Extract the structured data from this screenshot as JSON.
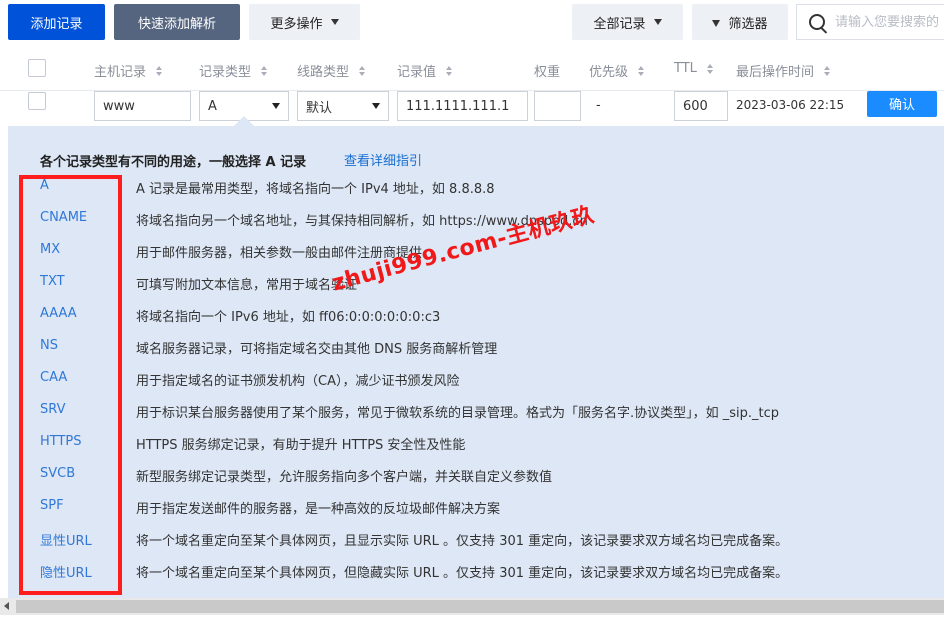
{
  "toolbar": {
    "add_record": "添加记录",
    "quick_add": "快速添加解析",
    "more_ops": "更多操作",
    "all_records": "全部记录",
    "filter": "筛选器",
    "search_placeholder": "请输入您要搜索的"
  },
  "columns": {
    "host": "主机记录",
    "type": "记录类型",
    "line": "线路类型",
    "value": "记录值",
    "weight": "权重",
    "priority": "优先级",
    "ttl": "TTL",
    "last_op": "最后操作时间"
  },
  "edit_row": {
    "host": "www",
    "type": "A",
    "line": "默认",
    "value": "111.1111.111.1",
    "weight": "",
    "priority": "-",
    "ttl": "600",
    "time": "2023-03-06 22:15",
    "confirm": "确认"
  },
  "panel": {
    "title": "各个记录类型有不同的用途，一般选择 A 记录",
    "link": "查看详细指引",
    "types": [
      {
        "name": "A",
        "desc": "A 记录是最常用类型，将域名指向一个 IPv4 地址，如 8.8.8.8"
      },
      {
        "name": "CNAME",
        "desc": "将域名指向另一个域名地址，与其保持相同解析，如 https://www.dnspod.cn"
      },
      {
        "name": "MX",
        "desc": "用于邮件服务器，相关参数一般由邮件注册商提供"
      },
      {
        "name": "TXT",
        "desc": "可填写附加文本信息，常用于域名验证"
      },
      {
        "name": "AAAA",
        "desc": "将域名指向一个 IPv6 地址，如 ff06:0:0:0:0:0:0:c3"
      },
      {
        "name": "NS",
        "desc": "域名服务器记录，可将指定域名交由其他 DNS 服务商解析管理"
      },
      {
        "name": "CAA",
        "desc": "用于指定域名的证书颁发机构（CA），减少证书颁发风险"
      },
      {
        "name": "SRV",
        "desc": "用于标识某台服务器使用了某个服务，常见于微软系统的目录管理。格式为「服务名字.协议类型」，如 _sip._tcp"
      },
      {
        "name": "HTTPS",
        "desc": "HTTPS 服务绑定记录，有助于提升 HTTPS 安全性及性能"
      },
      {
        "name": "SVCB",
        "desc": "新型服务绑定记录类型，允许服务指向多个客户端，并关联自定义参数值"
      },
      {
        "name": "SPF",
        "desc": "用于指定发送邮件的服务器，是一种高效的反垃圾邮件解决方案"
      },
      {
        "name": "显性URL",
        "desc": "将一个域名重定向至某个具体网页，且显示实际 URL 。仅支持 301 重定向，该记录要求双方域名均已完成备案。"
      },
      {
        "name": "隐性URL",
        "desc": "将一个域名重定向至某个具体网页，但隐藏实际 URL 。仅支持 301 重定向，该记录要求双方域名均已完成备案。"
      }
    ]
  },
  "watermark": "zhuji999.com-主机玖玖",
  "colors": {
    "primary": "#0052d9",
    "link": "#2f78d8",
    "panel_bg": "#dde7f5",
    "highlight": "#ff1d1d"
  }
}
